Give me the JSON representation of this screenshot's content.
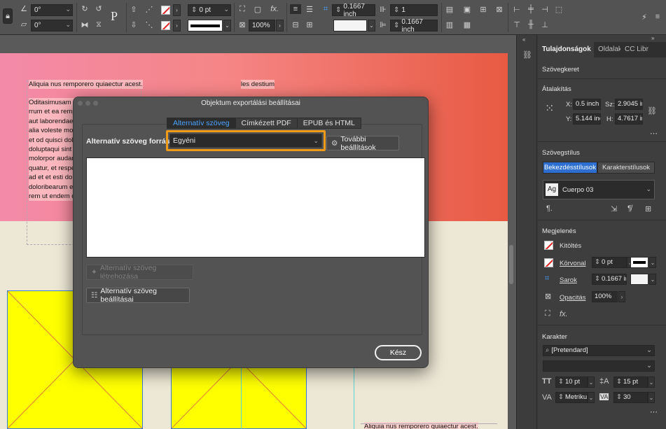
{
  "toolbar": {
    "rotate_angle": "0°",
    "shear_angle": "0°",
    "stroke_weight": "0 pt",
    "opacity": "100%",
    "corner_size_top": "0.1667 inch",
    "corner_size_bottom": "0.1667 inch",
    "columns": "1",
    "fx_label": "fx.",
    "p_glyph": "P"
  },
  "document": {
    "heading": "Aliquia nus remporero quiaectur acest.",
    "highlight_word": "les destium",
    "body_lines": [
      "Oditasimusam qui",
      "rrum et ea rempor",
      "aut laborendae se",
      "alia voleste molo",
      "et od quisci dolup",
      "doluptaqui sint o",
      "molorpor audanc",
      "quatur, et respe",
      "ad et et esti dolup",
      "doloribearum esel",
      "rem ut endem qu"
    ],
    "footer_text": "Aliquia nus remporero quiaectur acest."
  },
  "dialog": {
    "title": "Objektum exportálási beállításai",
    "tabs": [
      "Alternatív szöveg",
      "Címkézett PDF",
      "EPUB és HTML"
    ],
    "active_tab": 0,
    "source_label": "Alternatív szöveg forrása:",
    "source_value": "Egyéni",
    "more_settings": "További beállítások",
    "alt_text": "",
    "generate_button": "Alternatív szöveg létrehozása",
    "settings_button": "Alternatív szöveg beállításai",
    "done_button": "Kész"
  },
  "panel": {
    "tabs": [
      "Tulajdonságok",
      "Oldalak",
      "CC Libr"
    ],
    "section_frame": "Szövegkeret",
    "section_transform": "Átalakítás",
    "x_label": "X:",
    "x_value": "0.5 inch",
    "y_label": "Y:",
    "y_value": "5.144 inc",
    "w_label": "Sz:",
    "w_value": "2.9045 in",
    "h_label": "H:",
    "h_value": "4.7617 in",
    "section_textstyle": "Szövegstílus",
    "paragraph_styles": "Bekezdésstílusok",
    "character_styles": "Karakterstílusok",
    "style_name": "Cuerpo 03",
    "style_glyph": "Ag",
    "section_appearance": "Megjelenés",
    "fill_label": "Kitöltés",
    "stroke_label": "Körvonal",
    "stroke_value": "0 pt",
    "corner_label": "Sarok",
    "corner_value": "0.1667 ir",
    "opacity_label": "Opacitás",
    "opacity_value": "100%",
    "fx_label": "fx.",
    "section_character": "Karakter",
    "font_family": "[Pretendard]",
    "font_style": "",
    "font_size": "10 pt",
    "leading": "15 pt",
    "kerning": "Metriku",
    "tracking": "30"
  },
  "colors": {
    "accent_blue": "#4aa3ff",
    "focus_orange": "#f09a1a",
    "selected_segment": "#2c6fd1"
  }
}
